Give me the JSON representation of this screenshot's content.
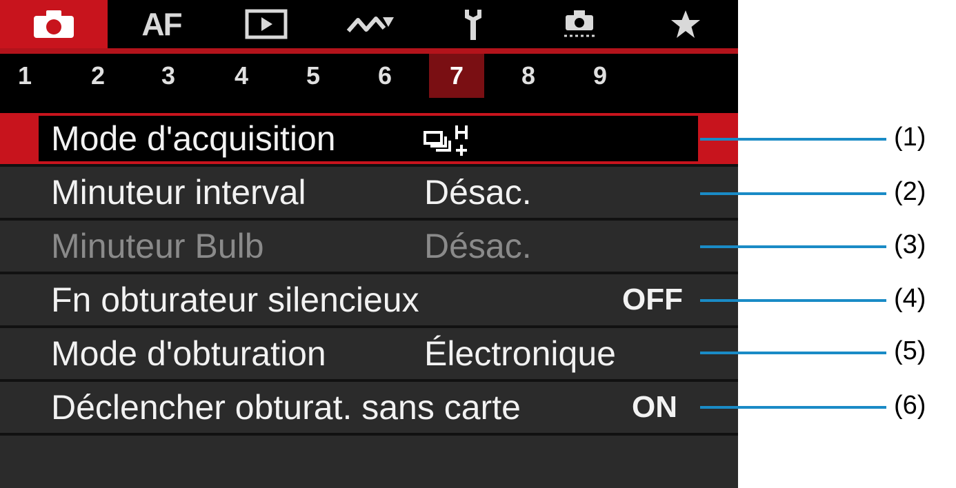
{
  "tabs": [
    {
      "name": "camera-icon",
      "active": true
    },
    {
      "name": "af",
      "label": "AF"
    },
    {
      "name": "playback-icon"
    },
    {
      "name": "wireless-icon"
    },
    {
      "name": "wrench-icon"
    },
    {
      "name": "custom-function-icon"
    },
    {
      "name": "star-icon"
    }
  ],
  "pages": [
    "1",
    "2",
    "3",
    "4",
    "5",
    "6",
    "7",
    "8",
    "9"
  ],
  "active_page": "7",
  "menu": [
    {
      "label": "Mode d'acquisition",
      "value_icon": "high-speed-continuous-icon"
    },
    {
      "label": "Minuteur interval",
      "value": "Désac."
    },
    {
      "label": "Minuteur Bulb",
      "value": "Désac.",
      "disabled": true
    },
    {
      "label": "Fn obturateur silencieux",
      "value": "OFF"
    },
    {
      "label": "Mode d'obturation",
      "value": "Électronique"
    },
    {
      "label": "Déclencher obturat. sans carte",
      "value": "ON"
    }
  ],
  "callouts": [
    "(1)",
    "(2)",
    "(3)",
    "(4)",
    "(5)",
    "(6)"
  ],
  "colors": {
    "accent_red": "#c8141d",
    "dark_red": "#7a0f13",
    "callout_blue": "#1a8bc6"
  }
}
